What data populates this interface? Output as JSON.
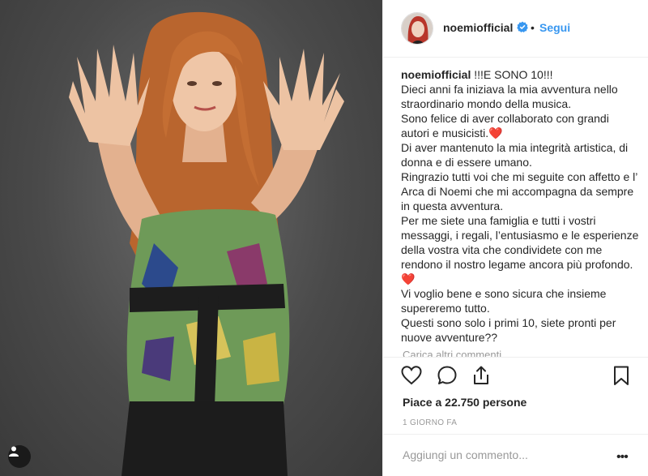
{
  "header": {
    "username": "noemiofficial",
    "separator": "•",
    "follow_label": "Segui"
  },
  "caption": {
    "author": "noemiofficial",
    "lines": [
      "!!!E SONO 10!!!",
      "Dieci anni fa iniziava la mia avventura nello straordinario mondo della musica.",
      "Sono felice di aver collaborato con grandi autori e musicisti.❤️",
      "Di aver mantenuto la mia integrità artistica, di donna e di essere umano.",
      "Ringrazio tutti voi che mi seguite con affetto e l’ Arca di Noemi che mi accompagna da sempre in questa avventura.",
      "Per me siete una famiglia e tutti i vostri messaggi, i regali, l’entusiasmo e le esperienze della vostra vita che condividete con me rendono il nostro legame ancora più profondo.❤️",
      "Vi voglio bene e sono sicura che insieme supereremo tutto.",
      "Questi sono solo i primi 10, siete pronti per nuove avventure??"
    ],
    "load_more": "Carica altri commenti"
  },
  "actions": {
    "icons": [
      "heart-icon",
      "comment-icon",
      "share-icon",
      "bookmark-icon"
    ]
  },
  "likes_text": "Piace a 22.750 persone",
  "timestamp": "1 GIORNO FA",
  "comment": {
    "placeholder": "Aggiungi un commento...",
    "value": "",
    "more_label": "•••"
  },
  "colors": {
    "link": "#3897f0",
    "verified": "#3897f0",
    "text": "#262626",
    "muted": "#999999",
    "heart": "#e0245e"
  }
}
